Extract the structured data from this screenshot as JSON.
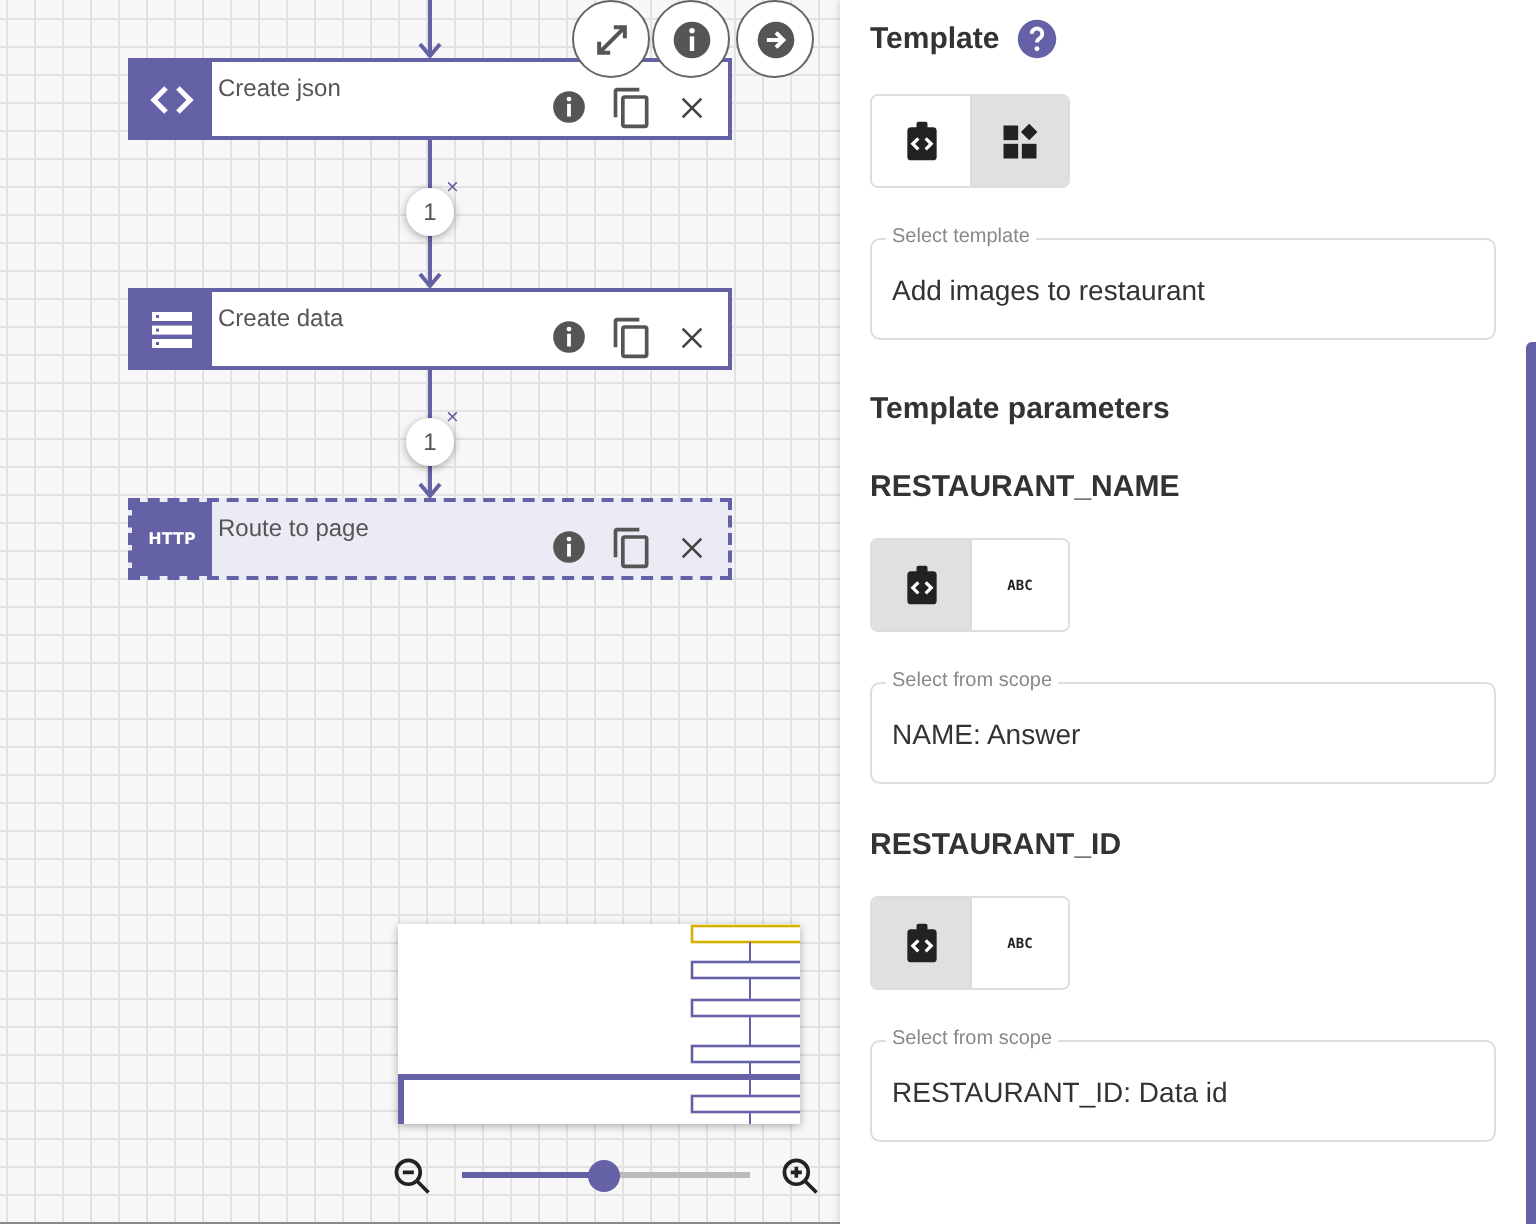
{
  "canvas": {
    "nodes": [
      {
        "title": "Create json",
        "icon": {
          "kind": "code"
        },
        "selected": false
      },
      {
        "title": "Create data",
        "icon": {
          "kind": "list"
        },
        "selected": false
      },
      {
        "title": "Route to page",
        "icon": {
          "kind": "text",
          "text": "HTTP"
        },
        "selected": true
      }
    ],
    "edges": [
      {
        "label": "1",
        "remove": "×"
      },
      {
        "label": "1",
        "remove": "×"
      }
    ],
    "zoom_slider": {
      "level": 0.49
    }
  },
  "panel": {
    "title": "Template",
    "template_source": [
      {
        "kind": "icon",
        "selected": false
      },
      {
        "kind": "grid",
        "selected": true
      }
    ],
    "template_field": {
      "label": "Select template",
      "value": "Add images to restaurant"
    },
    "parameters_title": "Template parameters",
    "parameters": [
      {
        "name": "RESTAURANT_NAME",
        "source": [
          {
            "kind": "icon",
            "selected": true
          },
          {
            "kind": "text",
            "label": "ABC",
            "selected": false
          }
        ],
        "field": {
          "label": "Select from scope",
          "value": "NAME: Answer"
        }
      },
      {
        "name": "RESTAURANT_ID",
        "source": [
          {
            "kind": "icon",
            "selected": true
          },
          {
            "kind": "text",
            "label": "ABC",
            "selected": false
          }
        ],
        "field": {
          "label": "Select from scope",
          "value": "RESTAURANT_ID: Data id"
        }
      }
    ]
  }
}
